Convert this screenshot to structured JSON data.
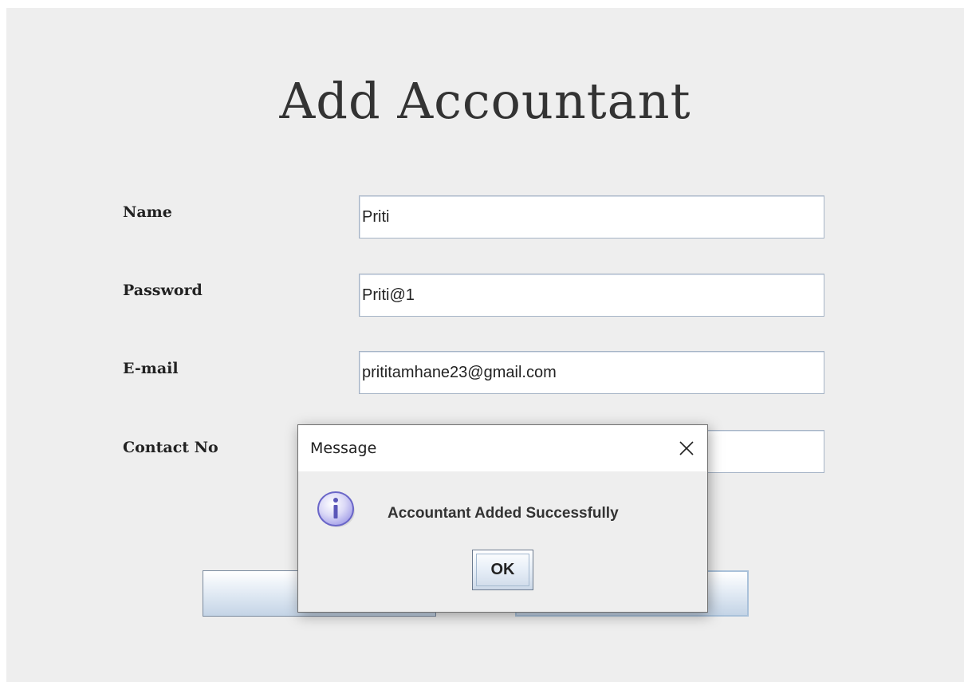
{
  "form": {
    "title": "Add Accountant",
    "fields": [
      {
        "label": "Name",
        "value": "Priti"
      },
      {
        "label": "Password",
        "value": "Priti@1"
      },
      {
        "label": "E-mail",
        "value": "prititamhane23@gmail.com"
      },
      {
        "label": "Contact No",
        "value": ""
      }
    ],
    "buttons": {
      "left_label": "",
      "right_label": ""
    }
  },
  "dialog": {
    "title": "Message",
    "message": "Accountant Added Successfully",
    "ok_label": "OK",
    "icon": "info-icon",
    "close_icon": "close-icon"
  },
  "colors": {
    "window_bg": "#eeeeee",
    "field_border": "#a6b4c6",
    "icon_fill": "#c9c6f2",
    "icon_stroke": "#6a66c8"
  }
}
